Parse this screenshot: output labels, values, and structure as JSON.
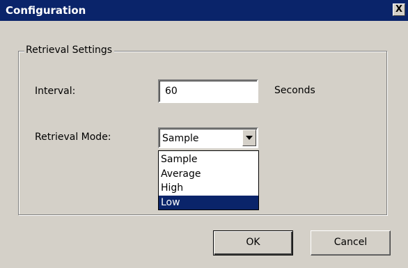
{
  "window": {
    "title": "Configuration",
    "close_label": "X"
  },
  "group": {
    "label": "Retrieval Settings"
  },
  "interval": {
    "label": "Interval:",
    "value": "60",
    "unit": "Seconds"
  },
  "retrieval_mode": {
    "label": "Retrieval Mode:",
    "selected": "Sample",
    "options": [
      "Sample",
      "Average",
      "High",
      "Low"
    ],
    "highlighted": "Low"
  },
  "buttons": {
    "ok_label": "OK",
    "cancel_label": "Cancel"
  },
  "icons": {
    "close": "close-icon",
    "dropdown": "chevron-down-icon"
  },
  "colors": {
    "title_bar": "#0a246a",
    "dialog_face": "#d4d0c8",
    "highlight": "#0a246a"
  }
}
